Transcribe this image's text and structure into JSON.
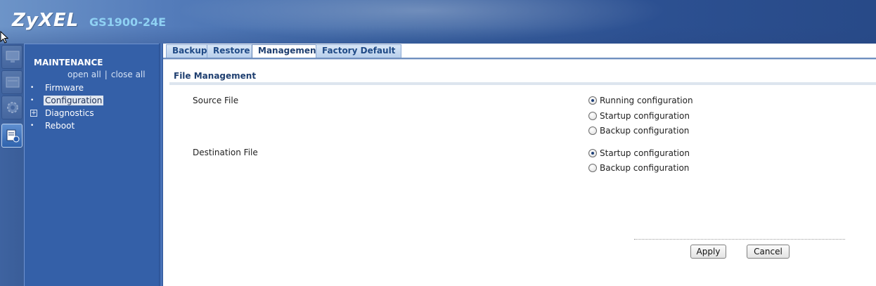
{
  "header": {
    "brand": "ZyXEL",
    "model": "GS1900-24E"
  },
  "icon_strip": {
    "icons": [
      "monitor-icon",
      "status-icon",
      "configuration-gear-icon",
      "maintenance-icon"
    ],
    "active_icon": "maintenance-icon"
  },
  "sidebar": {
    "title": "MAINTENANCE",
    "open_all": "open all",
    "separator": "|",
    "close_all": "close all",
    "items": [
      {
        "label": "Firmware",
        "expandable": false,
        "selected": false
      },
      {
        "label": "Configuration",
        "expandable": false,
        "selected": true
      },
      {
        "label": "Diagnostics",
        "expandable": true,
        "selected": false
      },
      {
        "label": "Reboot",
        "expandable": false,
        "selected": false
      }
    ]
  },
  "tabs": [
    {
      "label": "Backup",
      "active": false
    },
    {
      "label": "Restore",
      "active": false
    },
    {
      "label": "Management",
      "active": true
    },
    {
      "label": "Factory Default",
      "active": false
    }
  ],
  "main": {
    "section_title": "File Management",
    "source": {
      "label": "Source File",
      "options": [
        {
          "label": "Running configuration",
          "checked": true
        },
        {
          "label": "Startup configuration",
          "checked": false
        },
        {
          "label": "Backup configuration",
          "checked": false
        }
      ]
    },
    "destination": {
      "label": "Destination File",
      "options": [
        {
          "label": "Startup configuration",
          "checked": true
        },
        {
          "label": "Backup configuration",
          "checked": false
        }
      ]
    },
    "apply_label": "Apply",
    "cancel_label": "Cancel"
  },
  "colors": {
    "header_bg": "#3b64a3",
    "sidebar_bg": "#3460a8",
    "model_text": "#8fd1f3",
    "section_title": "#1f3f70"
  }
}
